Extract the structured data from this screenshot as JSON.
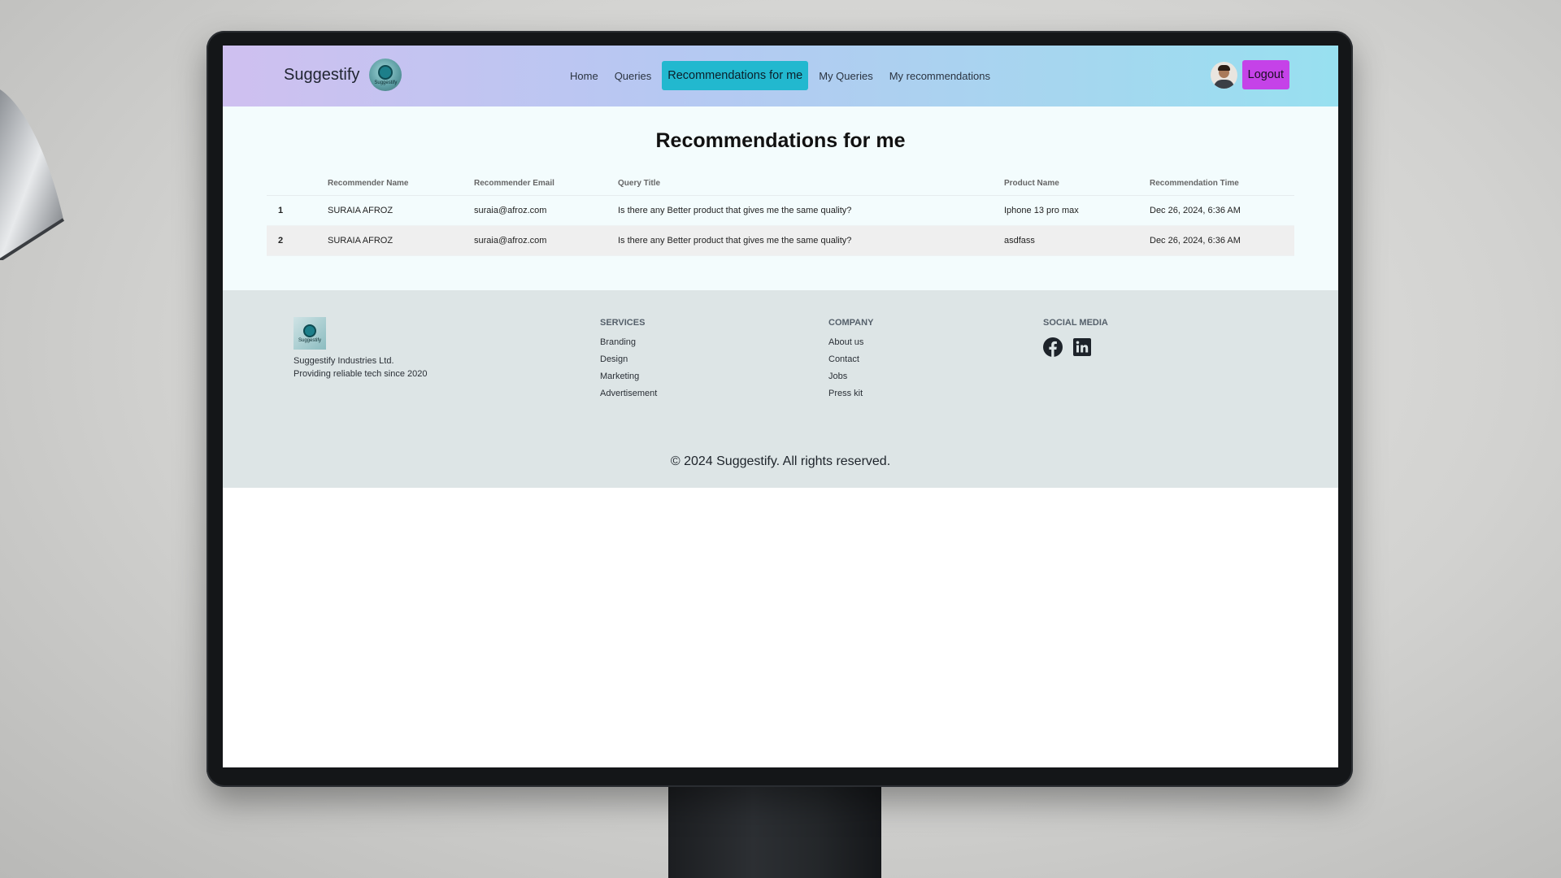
{
  "brand": {
    "name": "Suggestify",
    "logo_text": "Suggestify"
  },
  "nav": {
    "items": [
      {
        "label": "Home"
      },
      {
        "label": "Queries"
      },
      {
        "label": "Recommendations for me",
        "active": true
      },
      {
        "label": "My Queries"
      },
      {
        "label": "My recommendations"
      }
    ],
    "logout_label": "Logout"
  },
  "main": {
    "title": "Recommendations for me",
    "table": {
      "headers": [
        "",
        "Recommender Name",
        "Recommender Email",
        "Query Title",
        "Product Name",
        "Recommendation Time"
      ],
      "rows": [
        {
          "index": "1",
          "name": "SURAIA AFROZ",
          "email": "suraia@afroz.com",
          "query": "Is there any Better product that gives me the same quality?",
          "product": "Iphone 13 pro max",
          "time": "Dec 26, 2024, 6:36 AM"
        },
        {
          "index": "2",
          "name": "SURAIA AFROZ",
          "email": "suraia@afroz.com",
          "query": "Is there any Better product that gives me the same quality?",
          "product": "asdfass",
          "time": "Dec 26, 2024, 6:36 AM"
        }
      ]
    }
  },
  "footer": {
    "company_line1": "Suggestify Industries Ltd.",
    "company_line2": "Providing reliable tech since 2020",
    "services": {
      "title": "SERVICES",
      "links": [
        "Branding",
        "Design",
        "Marketing",
        "Advertisement"
      ]
    },
    "company": {
      "title": "COMPANY",
      "links": [
        "About us",
        "Contact",
        "Jobs",
        "Press kit"
      ]
    },
    "social": {
      "title": "SOCIAL MEDIA",
      "icons": [
        "facebook-icon",
        "linkedin-icon"
      ]
    },
    "copyright": "© 2024 Suggestify. All rights reserved."
  },
  "colors": {
    "active_nav": "#22b8cf",
    "logout": "#c542e8",
    "navbar_gradient_start": "#cfc0f0",
    "navbar_gradient_end": "#98e0f0",
    "footer_bg": "#dde5e6"
  }
}
